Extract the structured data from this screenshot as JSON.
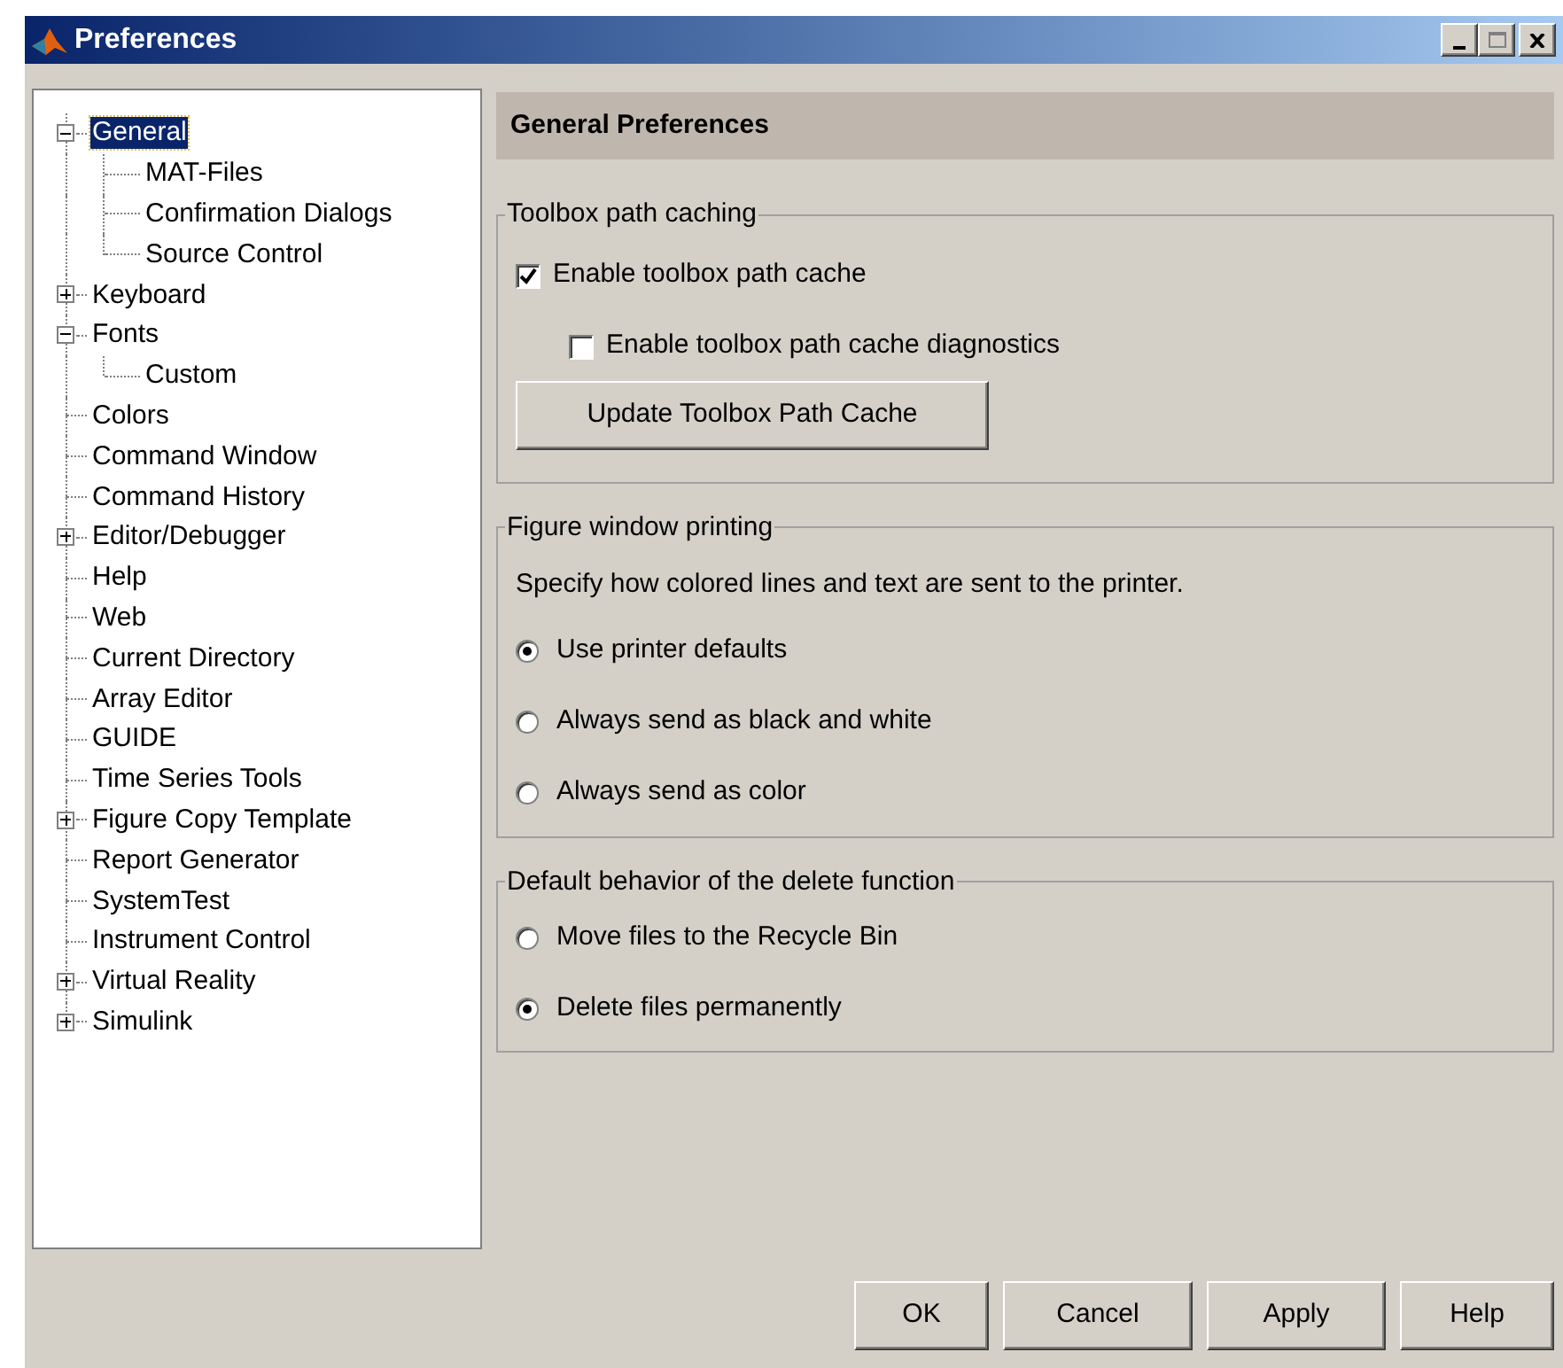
{
  "window": {
    "title": "Preferences"
  },
  "tree": [
    {
      "label": "General",
      "selected": true,
      "expanded": true,
      "children": [
        {
          "label": "MAT-Files",
          "selected": false
        },
        {
          "label": "Confirmation Dialogs",
          "selected": false
        },
        {
          "label": "Source Control",
          "selected": false
        }
      ]
    },
    {
      "label": "Keyboard",
      "selected": false,
      "expanded": false
    },
    {
      "label": "Fonts",
      "selected": false,
      "expanded": true,
      "children": [
        {
          "label": "Custom",
          "selected": false
        }
      ]
    },
    {
      "label": "Colors",
      "selected": false
    },
    {
      "label": "Command Window",
      "selected": false
    },
    {
      "label": "Command History",
      "selected": false
    },
    {
      "label": "Editor/Debugger",
      "selected": false,
      "expanded": false
    },
    {
      "label": "Help",
      "selected": false
    },
    {
      "label": "Web",
      "selected": false
    },
    {
      "label": "Current Directory",
      "selected": false
    },
    {
      "label": "Array Editor",
      "selected": false
    },
    {
      "label": "GUIDE",
      "selected": false
    },
    {
      "label": "Time Series Tools",
      "selected": false
    },
    {
      "label": "Figure Copy Template",
      "selected": false,
      "expanded": false
    },
    {
      "label": "Report Generator",
      "selected": false
    },
    {
      "label": "SystemTest",
      "selected": false
    },
    {
      "label": "Instrument Control",
      "selected": false
    },
    {
      "label": "Virtual Reality",
      "selected": false,
      "expanded": false
    },
    {
      "label": "Simulink",
      "selected": false,
      "expanded": false
    }
  ],
  "panel": {
    "title": "General Preferences",
    "groups": [
      {
        "title": "Toolbox path caching",
        "items": [
          {
            "kind": "checkbox",
            "label": "Enable toolbox path cache",
            "checked": true,
            "children": [
              {
                "kind": "checkbox",
                "label": "Enable toolbox path cache diagnostics",
                "checked": false
              }
            ]
          },
          {
            "kind": "button",
            "label": "Update Toolbox Path Cache"
          }
        ]
      },
      {
        "title": "Figure window printing",
        "items": [
          {
            "kind": "text",
            "label": "Specify how colored lines and text are sent to the printer."
          },
          {
            "kind": "radio",
            "label": "Use printer defaults",
            "selected": true
          },
          {
            "kind": "radio",
            "label": "Always send as black and white",
            "selected": false
          },
          {
            "kind": "radio",
            "label": "Always send as color",
            "selected": false
          }
        ]
      },
      {
        "title": "Default behavior of the delete function",
        "items": [
          {
            "kind": "radio",
            "label": "Move files to the Recycle Bin",
            "selected": false
          },
          {
            "kind": "radio",
            "label": "Delete files permanently",
            "selected": true
          }
        ]
      }
    ]
  },
  "buttons": [
    "OK",
    "Cancel",
    "Apply",
    "Help"
  ]
}
